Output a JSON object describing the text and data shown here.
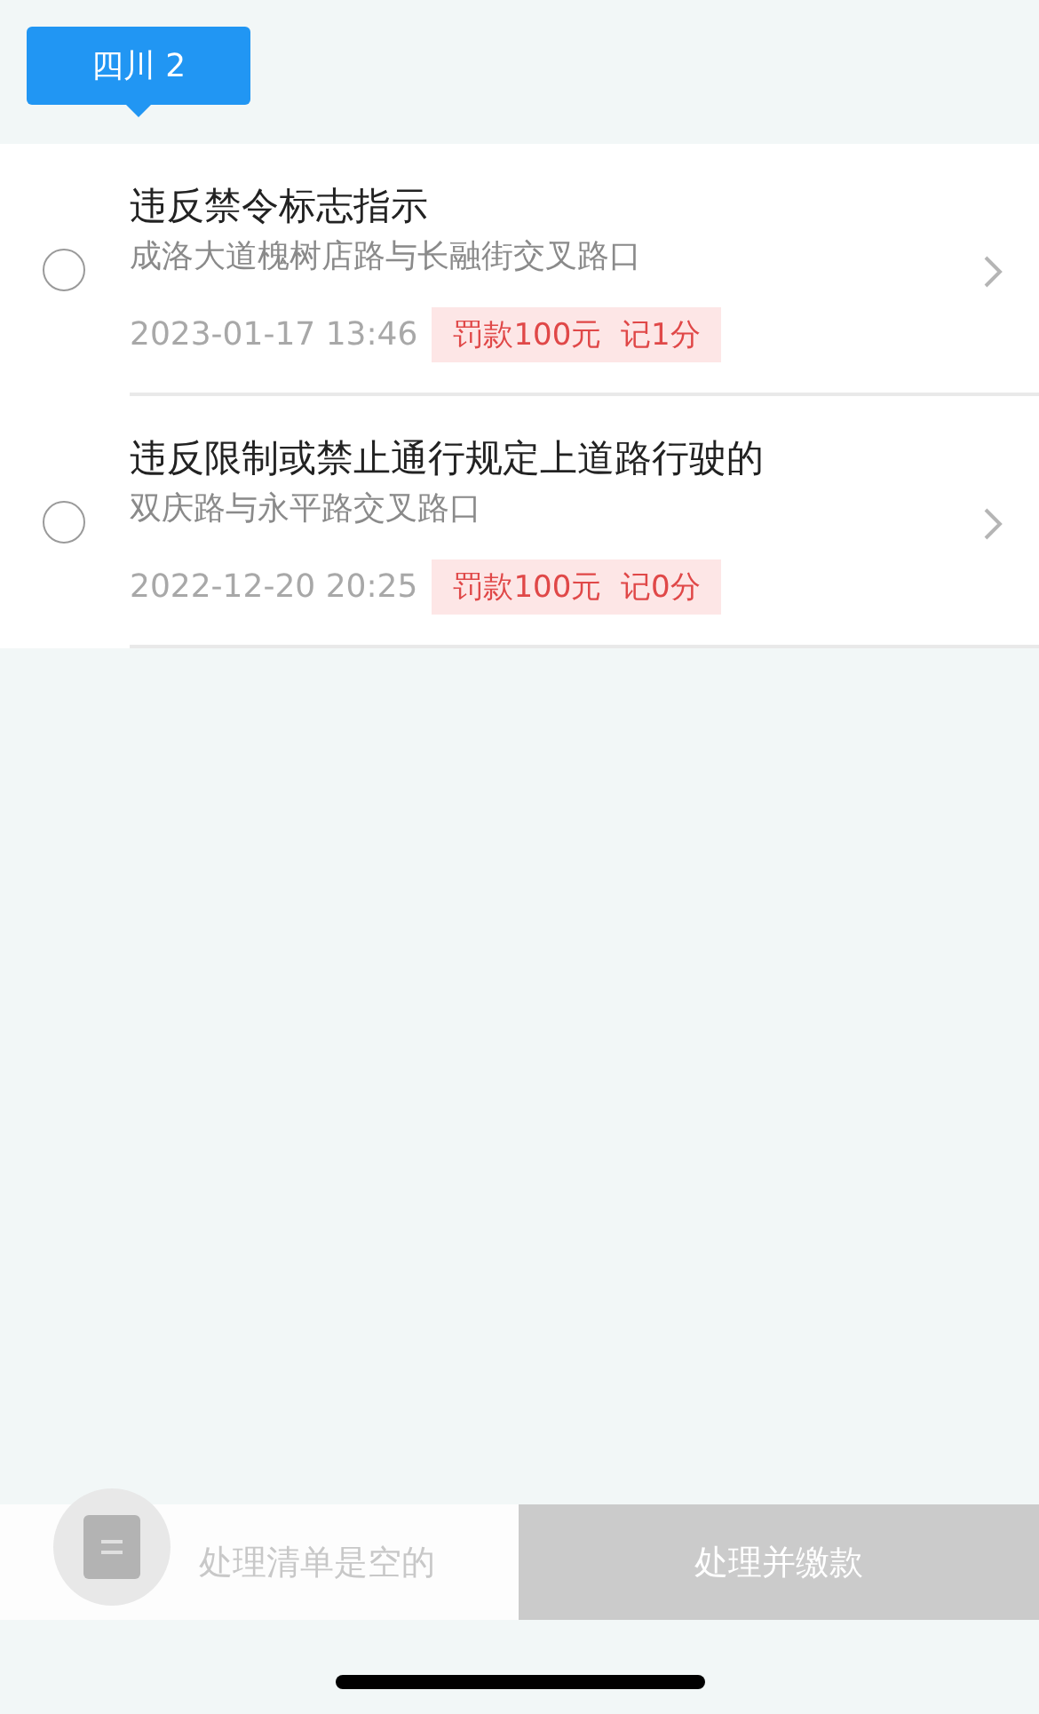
{
  "tabs": [
    {
      "label": "四川 2",
      "selected": true
    }
  ],
  "violations": [
    {
      "title": "违反禁令标志指示",
      "location": "成洛大道槐树店路与长融街交叉路口",
      "time": "2023-01-17 13:46",
      "penalty": "罚款100元  记1分",
      "selected": false
    },
    {
      "title": "违反限制或禁止通行规定上道路行驶的",
      "location": "双庆路与永平路交叉路口",
      "time": "2022-12-20 20:25",
      "penalty": "罚款100元  记0分",
      "selected": false
    }
  ],
  "bottom_bar": {
    "summary": "处理清单是空的",
    "button": {
      "label": "处理并缴款",
      "disabled": true
    }
  }
}
